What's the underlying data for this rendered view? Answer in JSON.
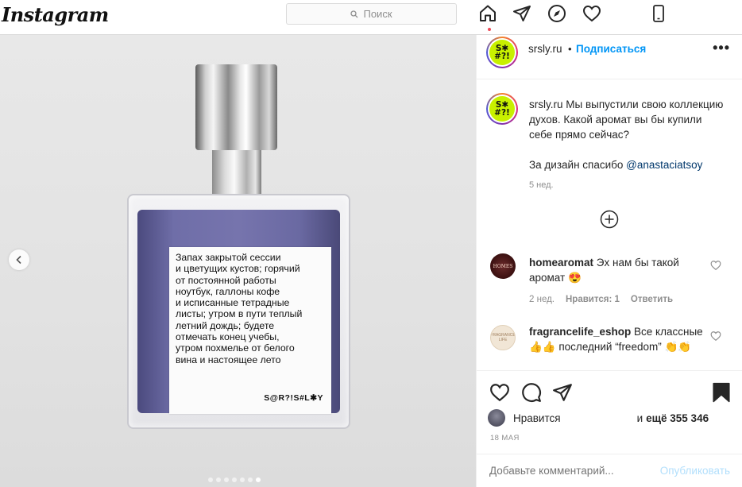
{
  "app": {
    "logo": "Instagram"
  },
  "search": {
    "placeholder": "Поиск"
  },
  "nav": {
    "icons": [
      "home-icon",
      "direct-icon",
      "explore-icon",
      "activity-icon",
      "phone-icon"
    ]
  },
  "photo": {
    "label_text": "Запах закрытой сессии\nи цветущих кустов; горячий\nот постоянной работы\nноутбук, галлоны кофе\nи исписанные тетрадные\nлисты; утром в пути теплый\nлетний дождь; будете\nотмечать конец учебы,\nутром похмелье от белого\nвина и настоящее лето",
    "label_brand": "S@R?!S#L✱Y",
    "slides_total": 7,
    "slide_active": 7
  },
  "header": {
    "avatar_text": "S✱\n#?!",
    "username": "srsly.ru",
    "bullet": "•",
    "follow": "Подписаться",
    "more": "•••"
  },
  "caption": {
    "username": "srsly.ru",
    "text": " Мы выпустили свою коллекцию духов. Какой аромат вы бы купили себе прямо сейчас?",
    "credit_prefix": "За дизайн спасибо ",
    "credit_mention": "@anastaciatsoy",
    "time": "5 нед."
  },
  "comments": [
    {
      "username": "homearomat",
      "text": " Эх нам бы такой аромат 😍",
      "avatar_text": "HOMES",
      "time": "2 нед.",
      "likes": "Нравится: 1",
      "reply": "Ответить"
    },
    {
      "username": "fragrancelife_eshop",
      "text": " Все классные 👍👍 последний “freedom” 👏👏",
      "avatar_text": "FRAGRANCE LIFE"
    }
  ],
  "likes": {
    "prefix": "Нравится",
    "conj": " и ",
    "count": "ещё 355 346"
  },
  "date": "18 МАЯ",
  "add_comment": {
    "placeholder": "Добавьте комментарий...",
    "publish": "Опубликовать"
  }
}
